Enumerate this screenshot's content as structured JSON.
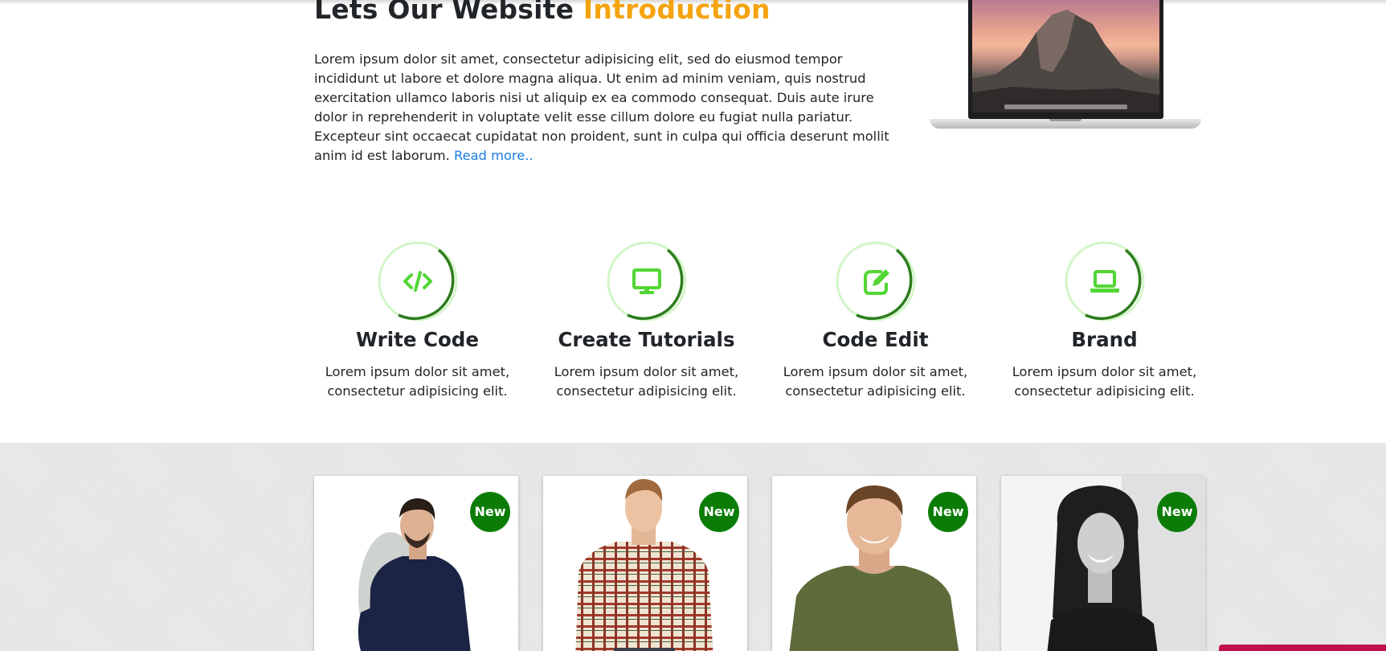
{
  "intro": {
    "title_main": "Lets Our Website",
    "title_accent": "Introduction",
    "body": "Lorem ipsum dolor sit amet, consectetur adipisicing elit, sed do eiusmod tempor incididunt ut labore et dolore magna aliqua. Ut enim ad minim veniam, quis nostrud exercitation ullamco laboris nisi ut aliquip ex ea commodo consequat. Duis aute irure dolor in reprehenderit in voluptate velit esse cillum dolore eu fugiat nulla pariatur. Excepteur sint occaecat cupidatat non proident, sunt in culpa qui officia deserunt mollit anim id est laborum.",
    "read_more": "Read more.."
  },
  "features": [
    {
      "icon": "code-icon",
      "title": "Write Code",
      "text": "Lorem ipsum dolor sit amet, consectetur adipisicing elit."
    },
    {
      "icon": "desktop-icon",
      "title": "Create Tutorials",
      "text": "Lorem ipsum dolor sit amet, consectetur adipisicing elit."
    },
    {
      "icon": "edit-icon",
      "title": "Code Edit",
      "text": "Lorem ipsum dolor sit amet, consectetur adipisicing elit."
    },
    {
      "icon": "laptop-icon",
      "title": "Brand",
      "text": "Lorem ipsum dolor sit amet, consectetur adipisicing elit."
    }
  ],
  "cards": [
    {
      "badge": "New"
    },
    {
      "badge": "New"
    },
    {
      "badge": "New"
    },
    {
      "badge": "New"
    }
  ],
  "colors": {
    "accent": "#f5a30f",
    "link": "#1a7de0",
    "icon_green": "#52d635",
    "ring_dark": "#2e7d1e",
    "ring_light": "#d3f5c8",
    "badge_green": "#0b7d07",
    "corner_tab": "#c2104c"
  }
}
